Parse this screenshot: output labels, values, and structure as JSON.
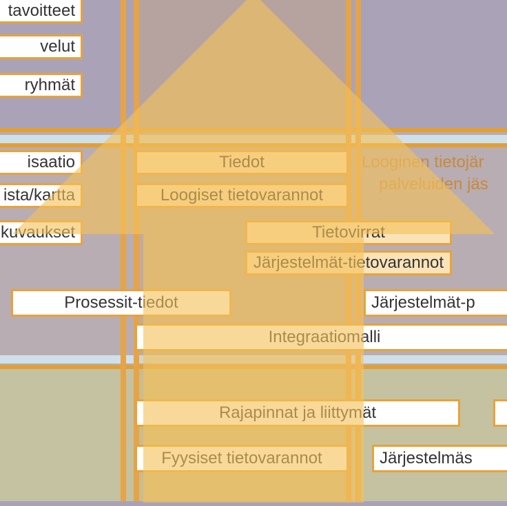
{
  "leftColumn": {
    "tavoitteet": "tavoitteet",
    "velut": "velut",
    "ryhmat": "ryhmät",
    "isaatio": "isaatio",
    "lista": "ista/kartta",
    "kuvaukset": "kuvaukset"
  },
  "center": {
    "tiedot": "Tiedot",
    "loogiset": "Loogiset tietovarannot",
    "tietovirrat": "Tietovirrat",
    "jarjTieto": "Järjestelmät-tietovarannot",
    "prosessit": "Prosessit-tiedot",
    "jarjP": "Järjestelmät-p",
    "integraatio": "Integraatiomalli",
    "rajapinnat": "Rajapinnat ja liittymät",
    "fyysiset": "Fyysiset tietovarannot",
    "jarjestelmas": "Järjestelmäs"
  },
  "right": {
    "line1": "Looginen tietojär",
    "line2": "palveluiden jäs"
  }
}
